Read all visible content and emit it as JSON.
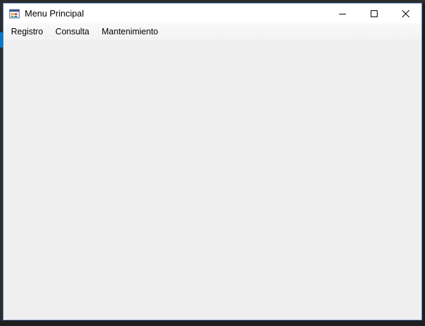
{
  "window": {
    "title": "Menu Principal",
    "icon": "windows-forms-app-icon",
    "caption_buttons": [
      "minimize-icon",
      "maximize-icon",
      "close-icon"
    ]
  },
  "menu": {
    "items": [
      {
        "label": "Registro"
      },
      {
        "label": "Consulta"
      },
      {
        "label": "Mantenimiento"
      }
    ]
  },
  "colors": {
    "titlebar": "#ffffff",
    "client_background": "#efefef",
    "window_border": "#4a6fa5"
  }
}
